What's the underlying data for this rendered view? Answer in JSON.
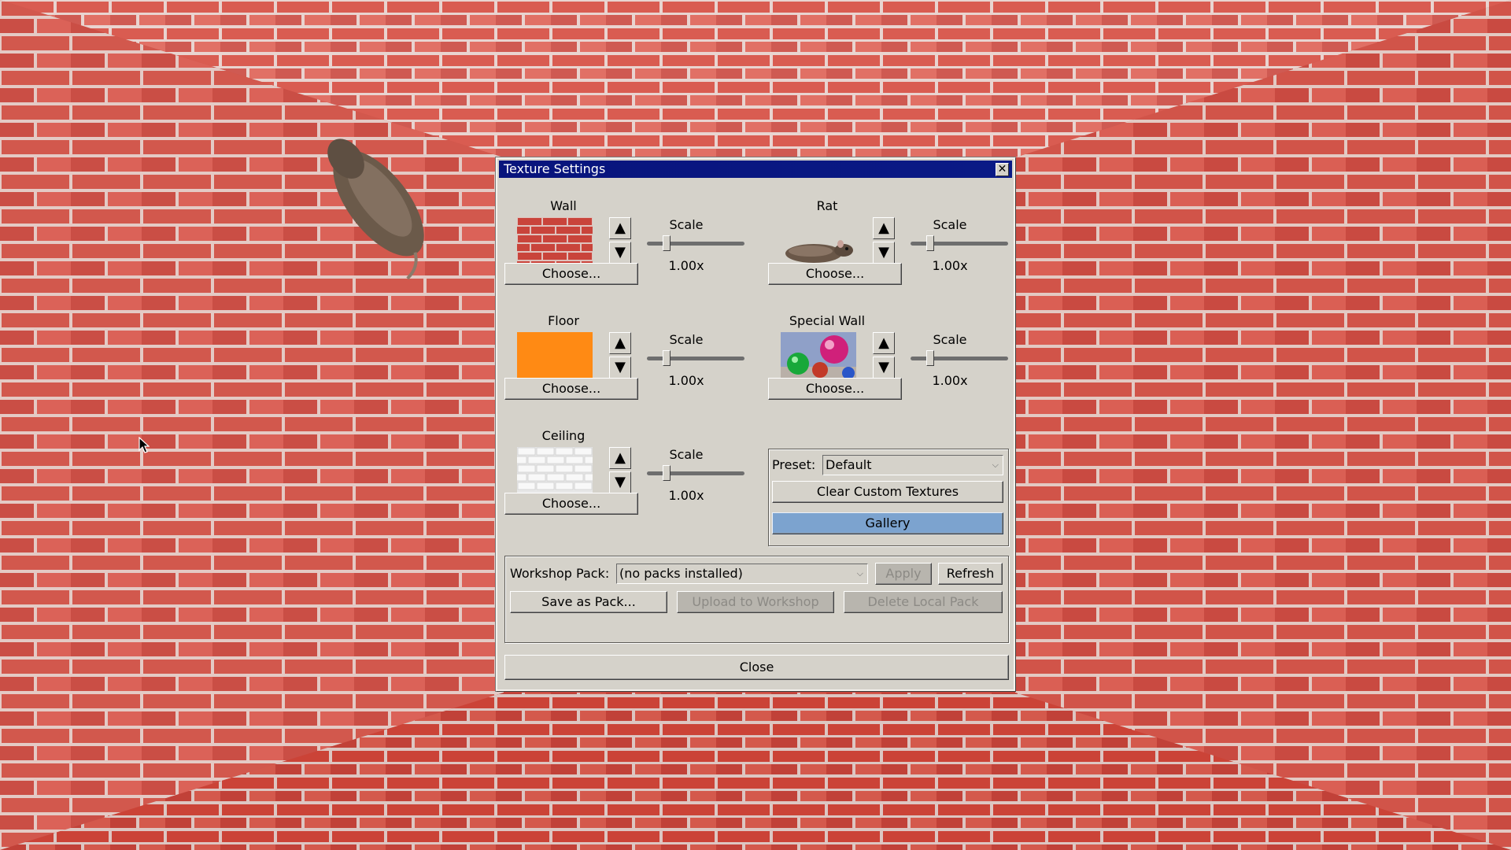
{
  "dialog": {
    "title": "Texture Settings",
    "close_glyph": "✕"
  },
  "textures": {
    "wall": {
      "label": "Wall",
      "choose": "Choose...",
      "scale_label": "Scale",
      "scale_value": "1.00x",
      "scale": 1.0
    },
    "rat": {
      "label": "Rat",
      "choose": "Choose...",
      "scale_label": "Scale",
      "scale_value": "1.00x",
      "scale": 1.0
    },
    "floor": {
      "label": "Floor",
      "choose": "Choose...",
      "scale_label": "Scale",
      "scale_value": "1.00x",
      "scale": 1.0
    },
    "special_wall": {
      "label": "Special Wall",
      "choose": "Choose...",
      "scale_label": "Scale",
      "scale_value": "1.00x",
      "scale": 1.0
    },
    "ceiling": {
      "label": "Ceiling",
      "choose": "Choose...",
      "scale_label": "Scale",
      "scale_value": "1.00x",
      "scale": 1.0
    }
  },
  "arrows": {
    "up": "▲",
    "down": "▼"
  },
  "preset": {
    "label": "Preset:",
    "value": "Default",
    "clear_button": "Clear Custom Textures",
    "gallery_button": "Gallery"
  },
  "workshop": {
    "label": "Workshop Pack:",
    "value": "(no packs installed)",
    "apply": "Apply",
    "refresh": "Refresh",
    "save_as_pack": "Save as Pack...",
    "upload": "Upload to Workshop",
    "delete_local": "Delete Local Pack"
  },
  "close_button": "Close",
  "colors": {
    "titlebar": "#08147c",
    "dialog_bg": "#d5d2ca",
    "gallery": "#7ca3cf",
    "floor_swatch": "#ff8a14",
    "brick": "#c8453c"
  },
  "icons": {
    "cursor": "arrow-cursor-icon",
    "rat": "rat-sprite",
    "close": "close-icon",
    "dropdown": "chevron-down-icon"
  }
}
